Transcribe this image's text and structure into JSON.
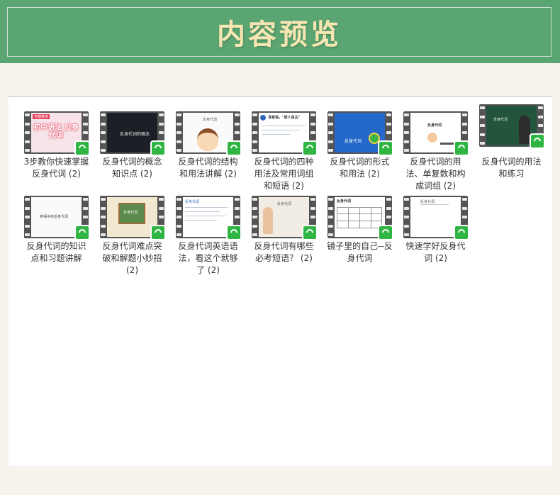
{
  "header": {
    "title": "内容预览"
  },
  "items": [
    {
      "caption": "3步教你快速掌握反身代词 (2)",
      "thumb_text": "初中语法 反身代词",
      "thumb_tag": "专题精讲"
    },
    {
      "caption": "反身代词的概念知识点 (2)",
      "thumb_text": "反身代词的概念"
    },
    {
      "caption": "反身代词的结构和用法讲解 (2)",
      "thumb_text": "反身代词"
    },
    {
      "caption": "反身代词的四种用法及常用词组和短语 (2)",
      "thumb_text": "寻家语，\"居人自古\""
    },
    {
      "caption": "反身代词的形式和用法 (2)",
      "thumb_text": "反身代词"
    },
    {
      "caption": "反身代词的用法、单复数和构成词组 (2)",
      "thumb_text": "反身代词"
    },
    {
      "caption": "反身代词的用法和练习",
      "thumb_text": "反身代词"
    },
    {
      "caption": "反身代词的知识点和习题讲解",
      "thumb_text": "英语中的反身代词"
    },
    {
      "caption": "反身代词难点突破和解题小妙招 (2)",
      "thumb_text": "反身代词"
    },
    {
      "caption": "反身代词英语语法，看这个就够了 (2)",
      "thumb_text": "反身代词"
    },
    {
      "caption": "反身代词有哪些必考短语？ (2)",
      "thumb_text": "反身代词"
    },
    {
      "caption": "镜子里的自己--反身代词",
      "thumb_text": "反身代词"
    },
    {
      "caption": "快速学好反身代词 (2)",
      "thumb_text": "反身代词"
    }
  ],
  "colors": {
    "banner": "#5aa571",
    "badge": "#2fb542",
    "title": "#f7e6b2"
  },
  "icons": {
    "badge": "play-badge-icon"
  }
}
